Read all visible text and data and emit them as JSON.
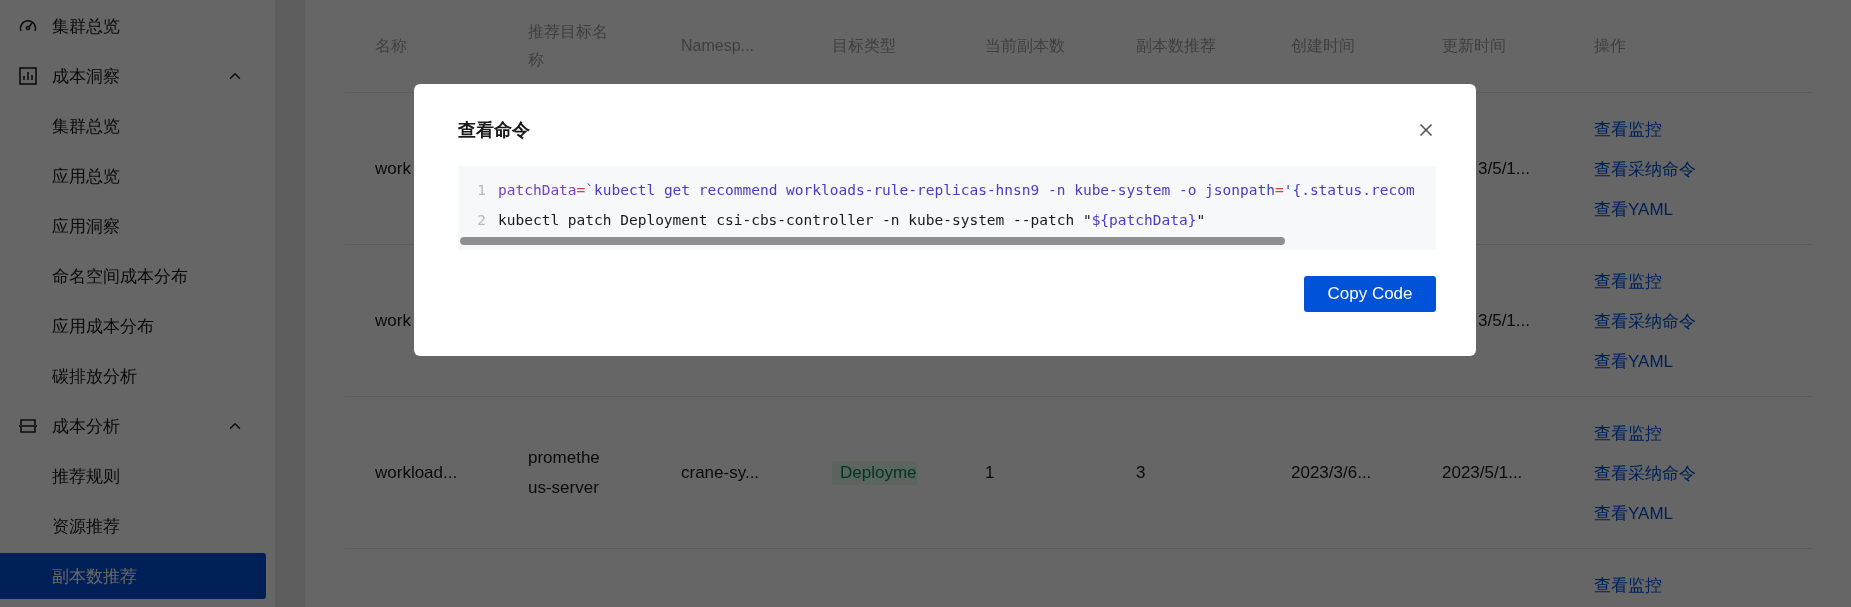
{
  "sidebar": {
    "items": [
      {
        "label": "集群总览",
        "selected": false
      },
      {
        "label": "成本洞察",
        "selected": false,
        "expanded": true,
        "children": [
          {
            "label": "集群总览",
            "selected": false
          },
          {
            "label": "应用总览",
            "selected": false
          },
          {
            "label": "应用洞察",
            "selected": false
          },
          {
            "label": "命名空间成本分布",
            "selected": false
          },
          {
            "label": "应用成本分布",
            "selected": false
          },
          {
            "label": "碳排放分析",
            "selected": false
          }
        ]
      },
      {
        "label": "成本分析",
        "selected": false,
        "expanded": true,
        "children": [
          {
            "label": "推荐规则",
            "selected": false
          },
          {
            "label": "资源推荐",
            "selected": false
          },
          {
            "label": "副本数推荐",
            "selected": true
          }
        ]
      }
    ]
  },
  "table": {
    "columns": [
      "名称",
      "推荐目标名称",
      "Namesp...",
      "目标类型",
      "当前副本数",
      "副本数推荐",
      "创建时间",
      "更新时间",
      "操作"
    ],
    "rows": [
      {
        "name": "work",
        "updated_time": "3/5/1...",
        "actions": [
          "查看监控",
          "查看采纳命令",
          "查看YAML"
        ]
      },
      {
        "name": "work",
        "updated_time": "3/5/1...",
        "actions": [
          "查看监控",
          "查看采纳命令",
          "查看YAML"
        ]
      },
      {
        "name": "workload...",
        "target_name": "prometheus-server",
        "namespace": "crane-sy...",
        "target_type": "Deployme",
        "current_replicas": "1",
        "recommended_replicas": "3",
        "created_time": "2023/3/6...",
        "updated_time": "2023/5/1...",
        "actions": [
          "查看监控",
          "查看采纳命令",
          "查看YAML"
        ]
      },
      {
        "actions": [
          "查看监控"
        ]
      }
    ]
  },
  "dialog": {
    "title": "查看命令",
    "code_lines": [
      {
        "number": "1",
        "tokens": [
          {
            "kind": "variable",
            "text": "patchData"
          },
          {
            "kind": "operator",
            "text": "="
          },
          {
            "kind": "string",
            "text": "`kubectl get recommend workloads-rule-replicas-hnsn9 -n kube-system -o jsonpath"
          },
          {
            "kind": "operator",
            "text": "="
          },
          {
            "kind": "string",
            "text": "'{.status.recom"
          }
        ]
      },
      {
        "number": "2",
        "tokens": [
          {
            "kind": "plain",
            "text": "kubectl patch Deployment csi-cbs-controller -n kube-system --patch "
          },
          {
            "kind": "plain",
            "text": "\""
          },
          {
            "kind": "string",
            "text": "${patchData}"
          },
          {
            "kind": "plain",
            "text": "\""
          }
        ]
      }
    ],
    "button": "Copy Code"
  }
}
